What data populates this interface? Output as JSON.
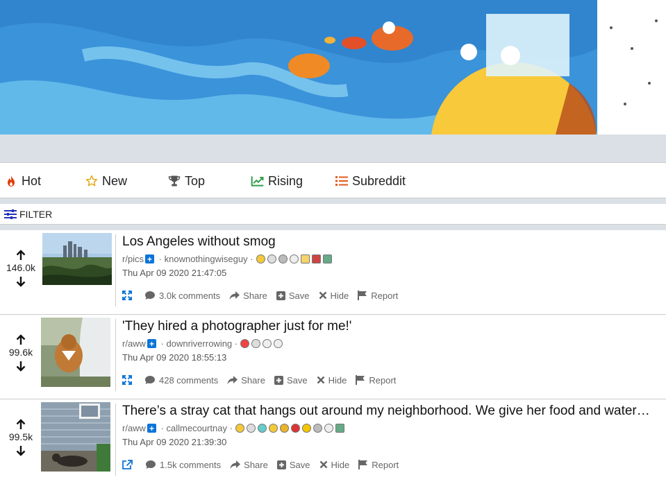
{
  "sort_tabs": [
    {
      "label": "Hot",
      "icon": "flame-icon",
      "color": "#e03c0a"
    },
    {
      "label": "New",
      "icon": "star-outline-icon",
      "color": "#e6a817"
    },
    {
      "label": "Top",
      "icon": "trophy-icon",
      "color": "#555555"
    },
    {
      "label": "Rising",
      "icon": "trending-up-icon",
      "color": "#2e9d4a"
    },
    {
      "label": "Subreddit",
      "icon": "list-icon",
      "color": "#e05a1d"
    }
  ],
  "filter": {
    "label": "FILTER",
    "icon": "filter-sliders-icon",
    "color": "#2432b8"
  },
  "posts": [
    {
      "score": "146.0k",
      "title": "Los Angeles without smog",
      "subreddit": "r/pics",
      "author": "knownothingwiseguy",
      "date": "Thu Apr 09 2020 21:47:05",
      "comments": "3.0k comments",
      "expand_icon": "expand-arrows-icon",
      "award_count": 8
    },
    {
      "score": "99.6k",
      "title": "'They hired a photographer just for me!'",
      "subreddit": "r/aww",
      "author": "downriverrowing",
      "date": "Thu Apr 09 2020 18:55:13",
      "comments": "428 comments",
      "expand_icon": "expand-arrows-icon",
      "award_count": 4
    },
    {
      "score": "99.5k",
      "title": "There’s a stray cat that hangs out around my neighborhood. We give her food and water every day and today she brought her kittens to meet us!",
      "subreddit": "r/aww",
      "author": "callmecourtnay",
      "date": "Thu Apr 09 2020 21:39:30",
      "comments": "1.5k comments",
      "expand_icon": "external-link-icon",
      "award_count": 10
    }
  ],
  "actions": {
    "share": "Share",
    "save": "Save",
    "hide": "Hide",
    "report": "Report"
  },
  "colors": {
    "accent": "#0b74d8",
    "background_band": "#dae0e6"
  }
}
